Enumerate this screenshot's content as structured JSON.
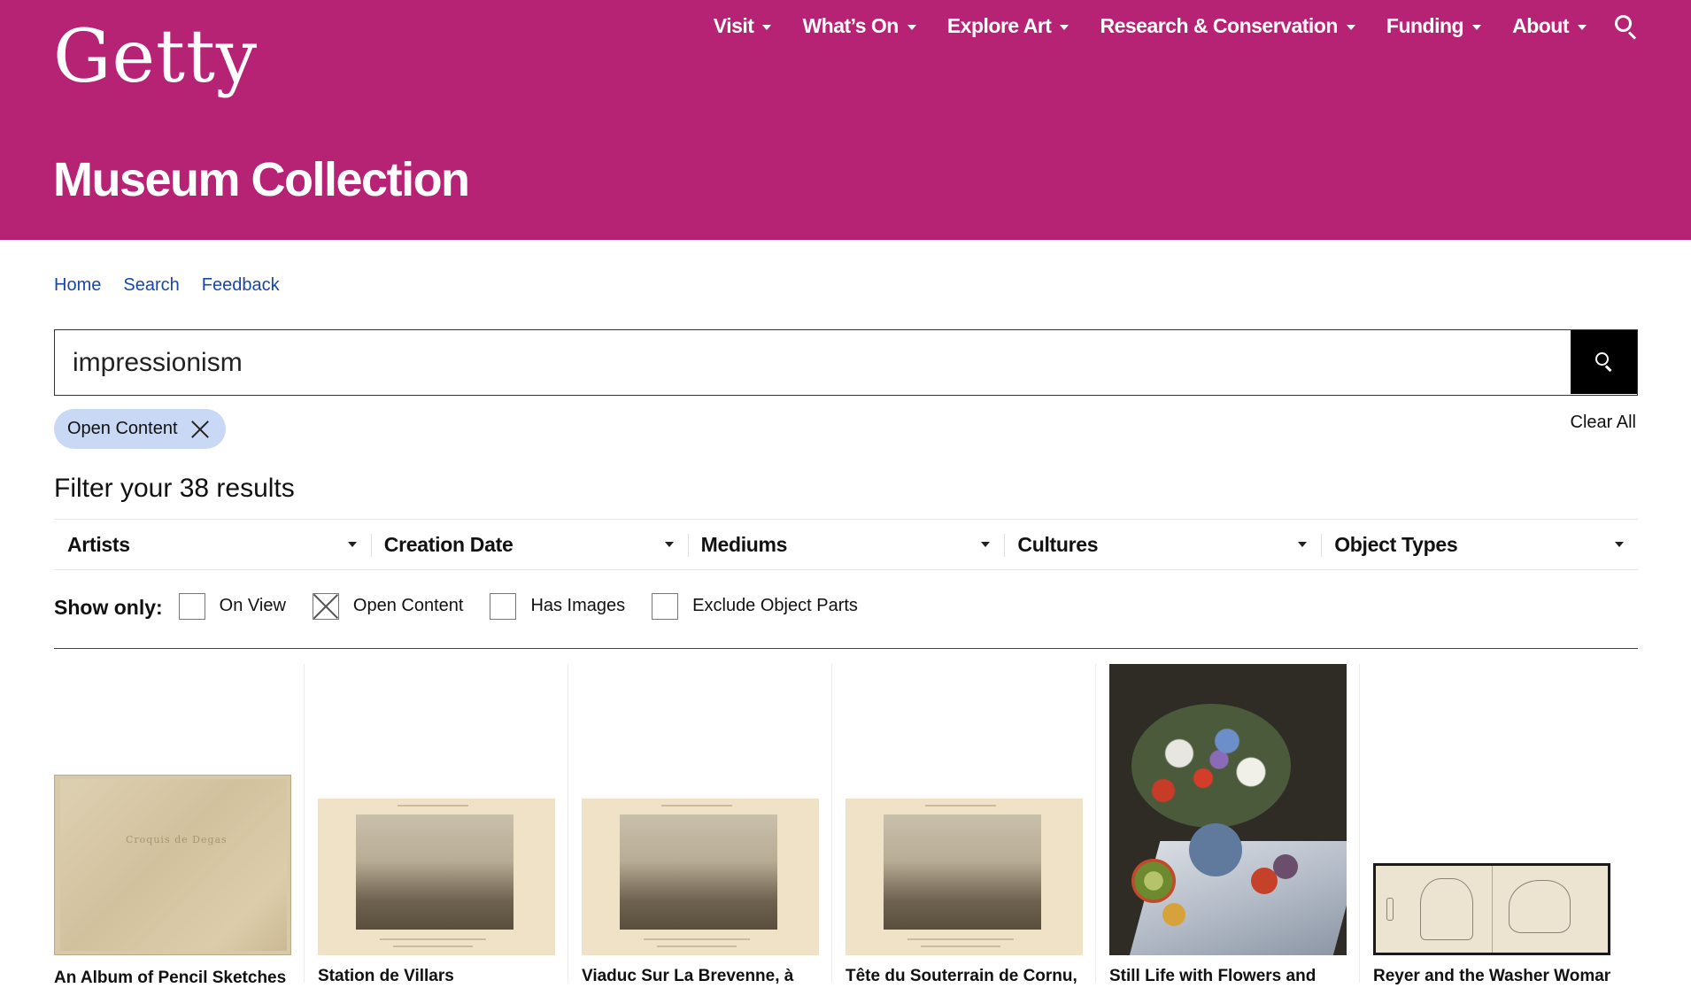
{
  "header": {
    "logo": "Getty",
    "nav": [
      {
        "label": "Visit"
      },
      {
        "label": "What’s On"
      },
      {
        "label": "Explore Art"
      },
      {
        "label": "Research & Conservation"
      },
      {
        "label": "Funding"
      },
      {
        "label": "About"
      }
    ],
    "page_title": "Museum Collection",
    "brand_color": "#b72374"
  },
  "breadcrumb": [
    "Home",
    "Search",
    "Feedback"
  ],
  "search": {
    "value": "impressionism"
  },
  "active_filters": [
    {
      "label": "Open Content"
    }
  ],
  "clear_all": "Clear All",
  "filter_title": "Filter your 38 results",
  "filters": [
    "Artists",
    "Creation Date",
    "Mediums",
    "Cultures",
    "Object Types"
  ],
  "show_only": {
    "label": "Show only:",
    "options": [
      {
        "label": "On View",
        "checked": false
      },
      {
        "label": "Open Content",
        "checked": true
      },
      {
        "label": "Has Images",
        "checked": false
      },
      {
        "label": "Exclude Object Parts",
        "checked": false
      }
    ]
  },
  "results": [
    {
      "title": "An Album of Pencil Sketches",
      "image_text": "Croquis de Degas"
    },
    {
      "title": "Station de Villars"
    },
    {
      "title": "Viaduc Sur La Brevenne, à"
    },
    {
      "title": "Tête du Souterrain de Cornu,"
    },
    {
      "title": "Still Life with Flowers and"
    },
    {
      "title": "Reyer and the Washer Woman"
    }
  ]
}
